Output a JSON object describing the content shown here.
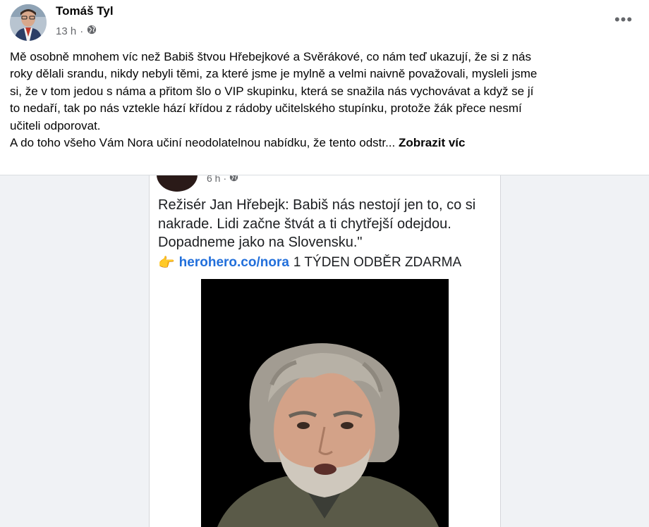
{
  "post": {
    "author": "Tomáš Tyl",
    "time": "13 h",
    "separator": "·",
    "audience_icon": "globe-icon",
    "more_icon": "ellipsis-icon",
    "more_label": "•••",
    "text_lines": [
      "Mě osobně mnohem víc než Babiš štvou Hřebejkové a Svěrákové, co nám teď ukazují, že si z nás",
      "roky dělali srandu, nikdy nebyli těmi, za které jsme je mylně a velmi naivně považovali, mysleli jsme",
      "si, že v tom jedou s náma a přitom šlo o VIP skupinku, která se snažila nás vychovávat a když se jí",
      "to nedaří, tak po nás vztekle hází křídou z rádoby učitelského stupínku, protože žák přece nesmí",
      "učiteli odporovat."
    ],
    "last_line": "A do toho všeho Vám Nora učiní neodolatelnou nabídku, že tento odstr...",
    "see_more": "Zobrazit víc"
  },
  "shared": {
    "time": "6 h",
    "separator": "·",
    "audience_icon": "globe-icon",
    "text_lines": [
      "Režisér Jan Hřebejk: Babiš nás nestojí jen to, co si",
      "nakrade. Lidi začne štvát a ti chytřejší odejdou.",
      "Dopadneme jako na Slovensku.\""
    ],
    "pointer_emoji": "👉",
    "link": "herohero.co/nora",
    "offer": "1 TÝDEN ODBĚR ZDARMA"
  }
}
